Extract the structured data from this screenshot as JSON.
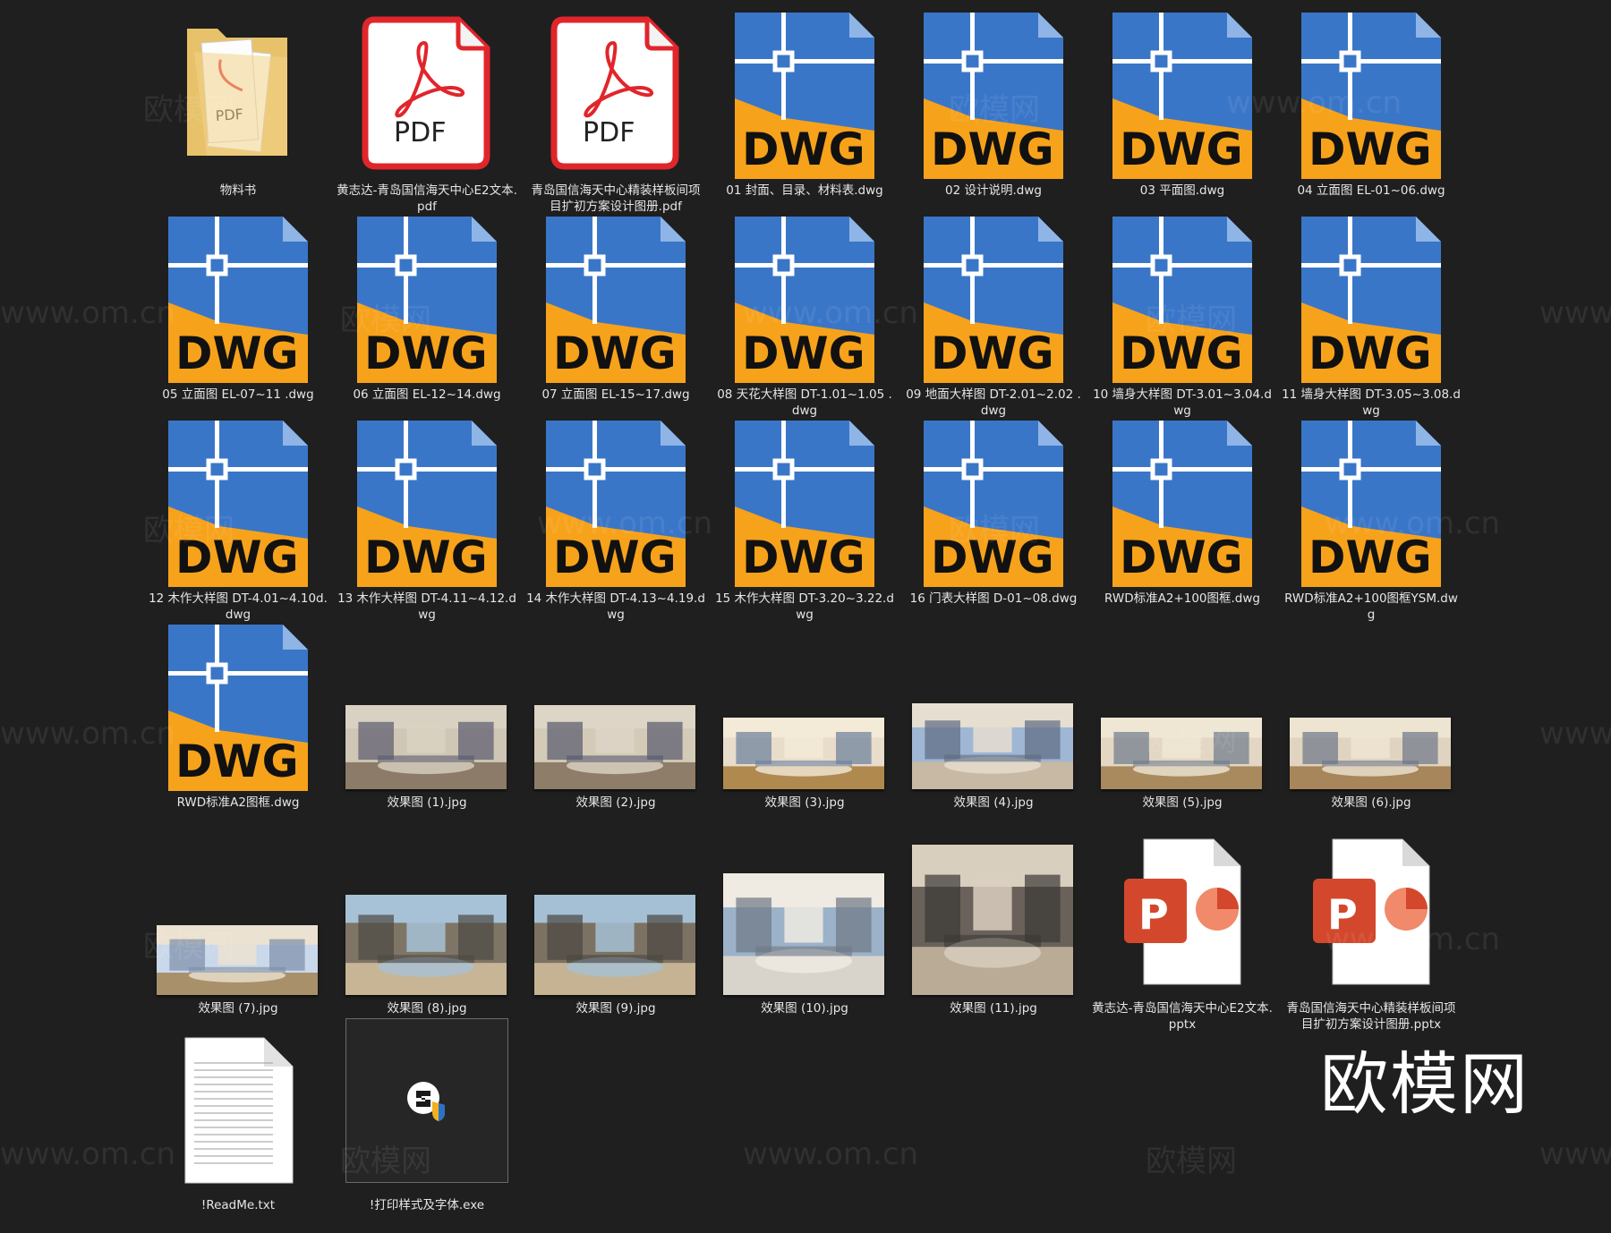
{
  "files": [
    {
      "name": "物料书",
      "type": "folder"
    },
    {
      "name": "黄志达-青岛国信海天中心E2文本.pdf",
      "type": "pdf"
    },
    {
      "name": "青岛国信海天中心精装样板间项目扩初方案设计图册.pdf",
      "type": "pdf"
    },
    {
      "name": "01 封面、目录、材料表.dwg",
      "type": "dwg"
    },
    {
      "name": "02 设计说明.dwg",
      "type": "dwg"
    },
    {
      "name": "03 平面图.dwg",
      "type": "dwg"
    },
    {
      "name": "04 立面图 EL-01~06.dwg",
      "type": "dwg"
    },
    {
      "name": "05 立面图 EL-07~11 .dwg",
      "type": "dwg"
    },
    {
      "name": "06 立面图 EL-12~14.dwg",
      "type": "dwg"
    },
    {
      "name": "07 立面图 EL-15~17.dwg",
      "type": "dwg"
    },
    {
      "name": "08 天花大样图 DT-1.01~1.05 .dwg",
      "type": "dwg"
    },
    {
      "name": "09 地面大样图 DT-2.01~2.02 .dwg",
      "type": "dwg"
    },
    {
      "name": "10 墙身大样图 DT-3.01~3.04.dwg",
      "type": "dwg"
    },
    {
      "name": "11 墙身大样图 DT-3.05~3.08.dwg",
      "type": "dwg"
    },
    {
      "name": "12 木作大样图 DT-4.01~4.10d.dwg",
      "type": "dwg"
    },
    {
      "name": "13 木作大样图 DT-4.11~4.12.dwg",
      "type": "dwg"
    },
    {
      "name": "14 木作大样图 DT-4.13~4.19.dwg",
      "type": "dwg"
    },
    {
      "name": "15 木作大样图 DT-3.20~3.22.dwg",
      "type": "dwg"
    },
    {
      "name": "16 门表大样图 D-01~08.dwg",
      "type": "dwg"
    },
    {
      "name": "RWD标准A2+100图框.dwg",
      "type": "dwg"
    },
    {
      "name": "RWD标准A2+100图框YSM.dwg",
      "type": "dwg"
    },
    {
      "name": "RWD标准A2图框.dwg",
      "type": "dwg"
    },
    {
      "name": "效果图 (1).jpg",
      "type": "jpg"
    },
    {
      "name": "效果图 (2).jpg",
      "type": "jpg"
    },
    {
      "name": "效果图 (3).jpg",
      "type": "jpg"
    },
    {
      "name": "效果图 (4).jpg",
      "type": "jpg"
    },
    {
      "name": "效果图 (5).jpg",
      "type": "jpg"
    },
    {
      "name": "效果图 (6).jpg",
      "type": "jpg"
    },
    {
      "name": "效果图 (7).jpg",
      "type": "jpg"
    },
    {
      "name": "效果图 (8).jpg",
      "type": "jpg"
    },
    {
      "name": "效果图 (9).jpg",
      "type": "jpg"
    },
    {
      "name": "效果图 (10).jpg",
      "type": "jpg"
    },
    {
      "name": "效果图 (11).jpg",
      "type": "jpg"
    },
    {
      "name": "黄志达-青岛国信海天中心E2文本.pptx",
      "type": "pptx"
    },
    {
      "name": "青岛国信海天中心精装样板间项目扩初方案设计图册.pptx",
      "type": "pptx"
    },
    {
      "name": "!ReadMe.txt",
      "type": "txt"
    },
    {
      "name": "!打印样式及字体.exe",
      "type": "exe"
    }
  ],
  "icon_text": {
    "dwg": "DWG",
    "pdf": "PDF",
    "pdf_small": "PDF",
    "pptx": "P"
  },
  "watermarks": [
    "欧模网",
    "www.om.cn"
  ],
  "brand": "欧模网",
  "colors": {
    "background": "#1f1f1f",
    "dwg_blue": "#3a76c8",
    "dwg_orange": "#f7a21b",
    "pdf_red": "#e0262b",
    "pptx_red": "#d3482c"
  }
}
